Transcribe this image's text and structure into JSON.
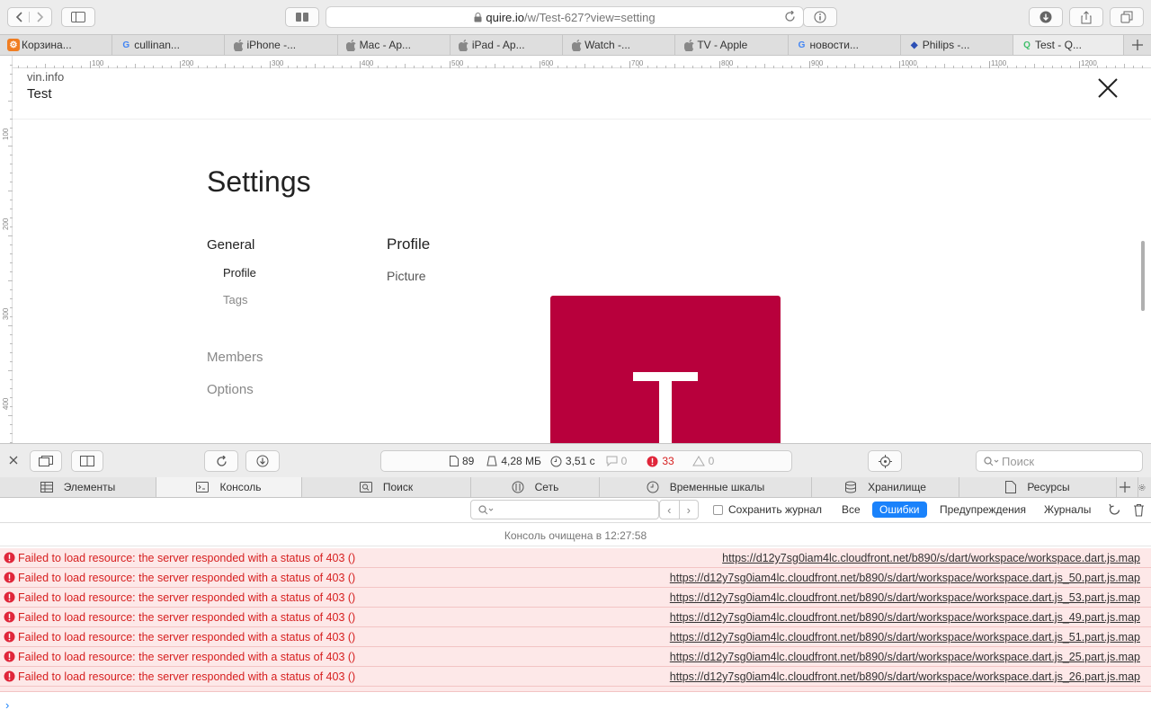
{
  "browser": {
    "address": "quire.io/w/Test-627?view=setting",
    "address_host": "quire.io",
    "address_path": "/w/Test-627?view=setting"
  },
  "tabs": [
    {
      "label": "Корзина...",
      "fav_color": "#f07d21",
      "fav_glyph": "⚙"
    },
    {
      "label": "cullinan...",
      "fav_color": "#4285f4",
      "fav_glyph": "G"
    },
    {
      "label": "iPhone -...",
      "fav_color": "#888888",
      "fav_glyph": ""
    },
    {
      "label": "Mac - Ap...",
      "fav_color": "#888888",
      "fav_glyph": ""
    },
    {
      "label": "iPad - Ap...",
      "fav_color": "#888888",
      "fav_glyph": ""
    },
    {
      "label": "Watch -...",
      "fav_color": "#888888",
      "fav_glyph": ""
    },
    {
      "label": "TV - Apple",
      "fav_color": "#888888",
      "fav_glyph": ""
    },
    {
      "label": "новости...",
      "fav_color": "#4285f4",
      "fav_glyph": "G"
    },
    {
      "label": "Philips -...",
      "fav_color": "#2b4fb5",
      "fav_glyph": "◆"
    },
    {
      "label": "Test - Q...",
      "fav_color": "#3fbf6a",
      "fav_glyph": "Q",
      "active": true
    }
  ],
  "ruler": {
    "top": [
      "100",
      "200",
      "300",
      "400",
      "500",
      "600",
      "700",
      "800",
      "900",
      "1000",
      "1100",
      "1200"
    ],
    "left": [
      "100",
      "200",
      "300",
      "400"
    ]
  },
  "page": {
    "workspace_name": "vin.info",
    "workspace_title": "Test",
    "settings_heading": "Settings",
    "nav": {
      "general": "General",
      "profile": "Profile",
      "tags": "Tags",
      "members": "Members",
      "options": "Options"
    },
    "profile_heading": "Profile",
    "picture_label": "Picture",
    "avatar_letter": "T",
    "avatar_color": "#b8003c"
  },
  "devtools": {
    "stats": {
      "resources": "89",
      "size": "4,28 МБ",
      "time": "3,51 с",
      "logs": "0",
      "errors": "33",
      "warnings": "0"
    },
    "search_placeholder": "Поиск",
    "tabs": [
      "Элементы",
      "Консоль",
      "Поиск",
      "Сеть",
      "Временные шкалы",
      "Хранилище",
      "Ресурсы"
    ],
    "active_tab": "Консоль",
    "preserve_log": "Сохранить журнал",
    "filters": [
      "Все",
      "Ошибки",
      "Предупреждения",
      "Журналы"
    ],
    "active_filter": "Ошибки",
    "cleared_message": "Консоль очищена в 12:27:58",
    "error_color": "#d61f1f",
    "messages": [
      {
        "text": "Failed to load resource: the server responded with a status of 403 ()",
        "url": "https://d12y7sg0iam4lc.cloudfront.net/b890/s/dart/workspace/workspace.dart.js.map"
      },
      {
        "text": "Failed to load resource: the server responded with a status of 403 ()",
        "url": "https://d12y7sg0iam4lc.cloudfront.net/b890/s/dart/workspace/workspace.dart.js_50.part.js.map"
      },
      {
        "text": "Failed to load resource: the server responded with a status of 403 ()",
        "url": "https://d12y7sg0iam4lc.cloudfront.net/b890/s/dart/workspace/workspace.dart.js_53.part.js.map"
      },
      {
        "text": "Failed to load resource: the server responded with a status of 403 ()",
        "url": "https://d12y7sg0iam4lc.cloudfront.net/b890/s/dart/workspace/workspace.dart.js_49.part.js.map"
      },
      {
        "text": "Failed to load resource: the server responded with a status of 403 ()",
        "url": "https://d12y7sg0iam4lc.cloudfront.net/b890/s/dart/workspace/workspace.dart.js_51.part.js.map"
      },
      {
        "text": "Failed to load resource: the server responded with a status of 403 ()",
        "url": "https://d12y7sg0iam4lc.cloudfront.net/b890/s/dart/workspace/workspace.dart.js_25.part.js.map"
      },
      {
        "text": "Failed to load resource: the server responded with a status of 403 ()",
        "url": "https://d12y7sg0iam4lc.cloudfront.net/b890/s/dart/workspace/workspace.dart.js_26.part.js.map"
      }
    ]
  }
}
